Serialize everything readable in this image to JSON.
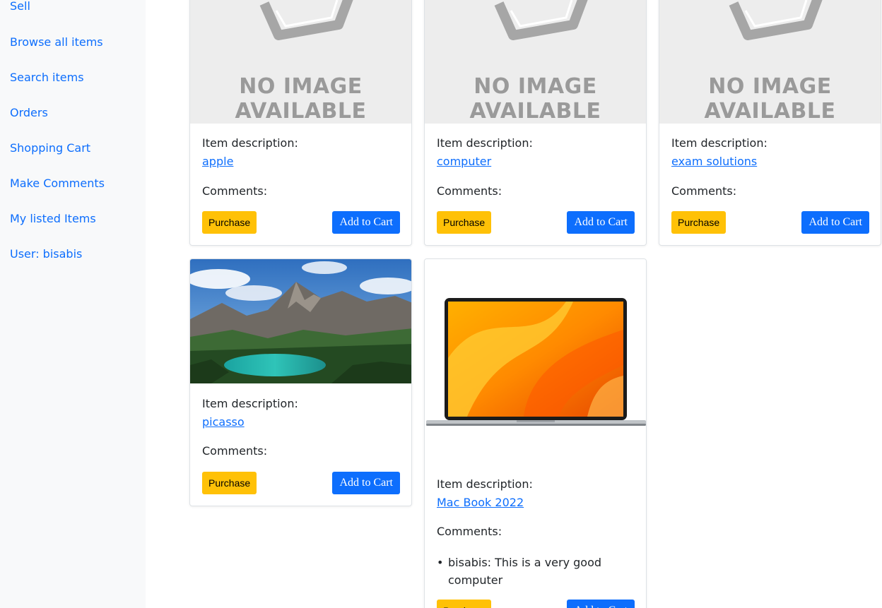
{
  "sidebar": {
    "items": [
      {
        "label": "Sell"
      },
      {
        "label": "Browse all items"
      },
      {
        "label": "Search items"
      },
      {
        "label": "Orders"
      },
      {
        "label": "Shopping Cart"
      },
      {
        "label": "Make Comments"
      },
      {
        "label": "My listed Items"
      },
      {
        "label": "User: bisabis"
      }
    ]
  },
  "placeholder": {
    "line1": "NO IMAGE",
    "line2": "AVAILABLE"
  },
  "labels": {
    "description": "Item description:",
    "comments": "Comments:",
    "purchase": "Purchase",
    "add_to_cart": "Add to Cart"
  },
  "items": [
    {
      "description": "apple",
      "image": "no-image-placeholder",
      "comments": []
    },
    {
      "description": "computer",
      "image": "no-image-placeholder",
      "comments": []
    },
    {
      "description": "exam solutions",
      "image": "no-image-placeholder",
      "comments": []
    },
    {
      "description": "picasso",
      "image": "mountain-lake-photo",
      "comments": []
    },
    {
      "description": "Mac Book 2022",
      "image": "laptop-photo",
      "comments": [
        "bisabis: This is a very good computer"
      ]
    }
  ],
  "colors": {
    "primary": "#0d6efd",
    "warning": "#ffc107",
    "sidebar_bg": "#f8f9fa"
  }
}
